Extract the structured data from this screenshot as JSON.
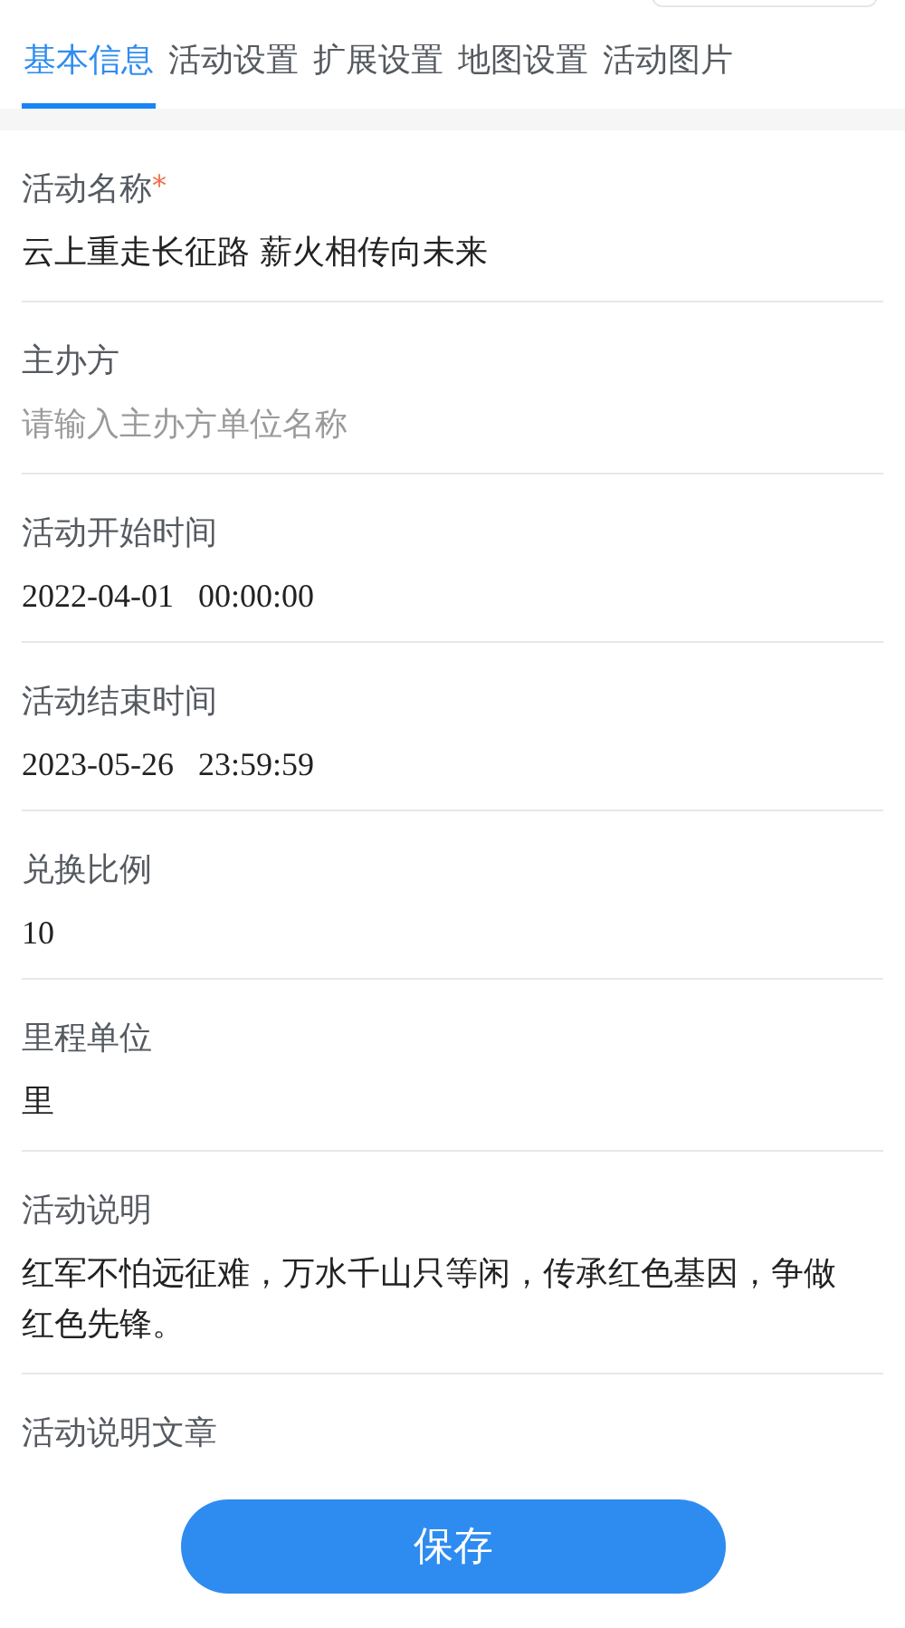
{
  "tabs": [
    {
      "label": "基本信息",
      "selected": true
    },
    {
      "label": "活动设置",
      "selected": false
    },
    {
      "label": "扩展设置",
      "selected": false
    },
    {
      "label": "地图设置",
      "selected": false
    },
    {
      "label": "活动图片",
      "selected": false
    }
  ],
  "fields": [
    {
      "kind": "text",
      "label": "活动名称",
      "required_mark": "*",
      "value": "云上重走长征路 薪火相传向未来"
    },
    {
      "kind": "text",
      "label": "主办方",
      "placeholder": "请输入主办方单位名称"
    },
    {
      "kind": "datetime",
      "label": "活动开始时间",
      "value": "2022-04-01   00:00:00"
    },
    {
      "kind": "datetime",
      "label": "活动结束时间",
      "value": "2023-05-26   23:59:59"
    },
    {
      "kind": "datetime",
      "label": "兑换比例",
      "value": "10"
    },
    {
      "kind": "text",
      "label": "里程单位",
      "value": "里"
    },
    {
      "kind": "text",
      "label": "活动说明",
      "value": "红军不怕远征难，万水千山只等闲，传承红色基因，争做红色先锋。"
    },
    {
      "kind": "none",
      "label": "活动说明文章"
    }
  ],
  "save_button": "保存"
}
